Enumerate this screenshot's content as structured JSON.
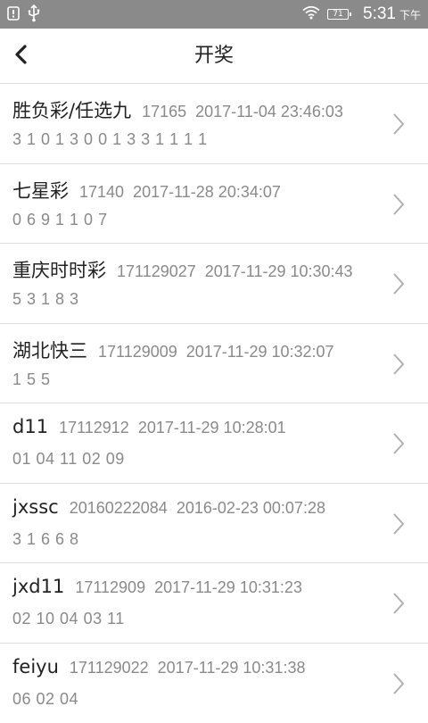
{
  "status_bar": {
    "battery_level": "71",
    "time": "5:31",
    "ampm": "下午",
    "icons": [
      "notification-icon",
      "usb-icon",
      "wifi-icon",
      "battery-icon"
    ]
  },
  "header": {
    "title": "开奖",
    "back_icon": "chevron-left-icon"
  },
  "results": [
    {
      "name": "胜负彩/任选九",
      "issue": "17165",
      "time": "2017-11-04 23:46:03",
      "numbers": "3 1 0 1 3 0 0 1 3 3 1 1 1 1"
    },
    {
      "name": "七星彩",
      "issue": "17140",
      "time": "2017-11-28 20:34:07",
      "numbers": "0 6 9 1 1 0 7"
    },
    {
      "name": "重庆时时彩",
      "issue": "171129027",
      "time": "2017-11-29 10:30:43",
      "numbers": "5 3 1 8 3"
    },
    {
      "name": "湖北快三",
      "issue": "171129009",
      "time": "2017-11-29 10:32:07",
      "numbers": "1 5 5"
    },
    {
      "name": "d11",
      "issue": "17112912",
      "time": "2017-11-29 10:28:01",
      "numbers": "01 04 11 02 09"
    },
    {
      "name": "jxssc",
      "issue": "20160222084",
      "time": "2016-02-23 00:07:28",
      "numbers": "3 1 6 6 8"
    },
    {
      "name": "jxd11",
      "issue": "17112909",
      "time": "2017-11-29 10:31:23",
      "numbers": "02 10 04 03 11"
    },
    {
      "name": "feiyu",
      "issue": "171129022",
      "time": "2017-11-29 10:31:38",
      "numbers": "06 02 04"
    }
  ],
  "colors": {
    "status_bar_bg": "#8a8a8a",
    "title_text": "#222222",
    "secondary_text": "#8a8a8a",
    "divider": "#dddddd",
    "chevron": "#b0b0b0"
  }
}
